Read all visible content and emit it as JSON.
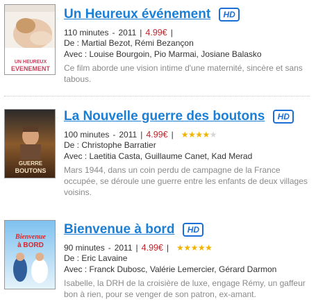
{
  "movies": [
    {
      "title": "Un Heureux événement",
      "hd_badge": "HD",
      "duration": "110 minutes",
      "year": "2011",
      "price": "4.99€",
      "rating": null,
      "director_line": "De : Martial Bezot, Rémi Bezançon",
      "cast_line": "Avec : Louise Bourgoin, Pio Marmai, Josiane Balasko",
      "description": "Ce film aborde une vision intime d'une maternité, sincère et sans tabous.",
      "poster_text": "UN HEUREUX ÉVÈNEMENT"
    },
    {
      "title": "La Nouvelle guerre des boutons",
      "hd_badge": "HD",
      "duration": "100 minutes",
      "year": "2011",
      "price": "4.99€",
      "rating": 4,
      "director_line": "De : Christophe Barratier",
      "cast_line": "Avec : Laetitia Casta, Guillaume Canet, Kad Merad",
      "description": "Mars 1944, dans un coin perdu de campagne de la France occupée, se déroule une guerre entre les enfants de deux villages voisins.",
      "poster_text": "GUERRE DES BOUTONS"
    },
    {
      "title": "Bienvenue à bord",
      "hd_badge": "HD",
      "duration": "90 minutes",
      "year": "2011",
      "price": "4.99€",
      "rating": 5,
      "director_line": "De : Eric Lavaine",
      "cast_line": "Avec : Franck Dubosc, Valérie Lemercier, Gérard Darmon",
      "description": "Isabelle, la DRH de la croisière de luxe, engage Rémy, un gaffeur bon à rien, pour se venger de son patron, ex-amant.",
      "poster_text": "Bienvenue à BORD"
    }
  ],
  "colors": {
    "title": "#1b7fd6",
    "price": "#c0262c",
    "star": "#f2b200",
    "description": "#8a8a8a"
  },
  "icons": {
    "hd": "hd-badge-icon",
    "star": "star-icon"
  }
}
